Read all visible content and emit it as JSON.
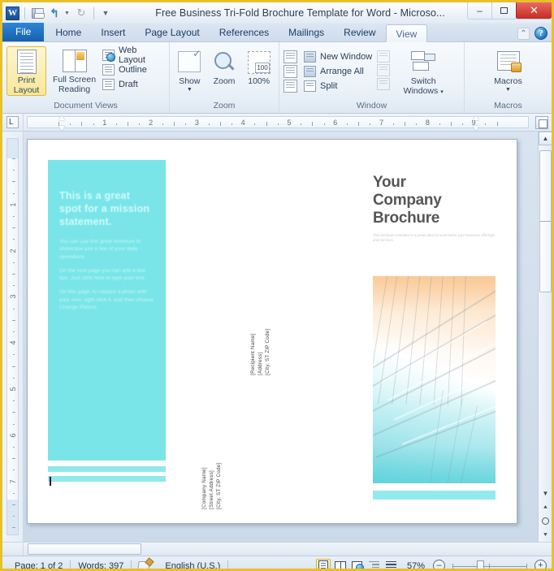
{
  "window": {
    "title": "Free Business Tri-Fold Brochure Template for Word  - Microso...",
    "app_icon": "W",
    "quick_access": [
      {
        "name": "save-icon",
        "label": "Save"
      },
      {
        "name": "undo-icon",
        "label": "Undo"
      },
      {
        "name": "redo-icon",
        "label": "Redo"
      },
      {
        "name": "customize-qat-icon",
        "label": "Customize Quick Access Toolbar"
      }
    ],
    "controls": {
      "minimize": "–",
      "maximize": "",
      "close": "✕"
    }
  },
  "tabs": [
    {
      "label": "File",
      "active": false,
      "is_file": true
    },
    {
      "label": "Home",
      "active": false
    },
    {
      "label": "Insert",
      "active": false
    },
    {
      "label": "Page Layout",
      "active": false
    },
    {
      "label": "References",
      "active": false
    },
    {
      "label": "Mailings",
      "active": false
    },
    {
      "label": "Review",
      "active": false
    },
    {
      "label": "View",
      "active": true
    }
  ],
  "tab_right": {
    "minimize_ribbon": "⌃",
    "help": "?"
  },
  "ribbon": {
    "groups": [
      {
        "name": "document-views",
        "label": "Document Views",
        "big_buttons": [
          {
            "label_line1": "Print",
            "label_line2": "Layout",
            "selected": true,
            "icon": "print-layout-icon"
          },
          {
            "label_line1": "Full Screen",
            "label_line2": "Reading",
            "selected": false,
            "icon": "full-screen-reading-icon"
          }
        ],
        "small_items": [
          {
            "label": "Web Layout",
            "icon": "web-layout-icon"
          },
          {
            "label": "Outline",
            "icon": "outline-icon"
          },
          {
            "label": "Draft",
            "icon": "draft-icon"
          }
        ]
      },
      {
        "name": "zoom",
        "label": "Zoom",
        "buttons": [
          {
            "label": "Show",
            "icon": "show-icon",
            "has_dropdown": true
          },
          {
            "label": "Zoom",
            "icon": "zoom-magnifier-icon",
            "has_dropdown": false
          },
          {
            "label": "100%",
            "icon": "one-hundred-percent-icon",
            "has_dropdown": false
          }
        ]
      },
      {
        "name": "window",
        "label": "Window",
        "small_items": [
          {
            "label": "New Window",
            "icon": "new-window-icon"
          },
          {
            "label": "Arrange All",
            "icon": "arrange-all-icon"
          },
          {
            "label": "Split",
            "icon": "split-icon"
          }
        ],
        "buttons": [
          {
            "label_line1": "Switch",
            "label_line2": "Windows",
            "icon": "switch-windows-icon",
            "has_dropdown": true
          }
        ]
      },
      {
        "name": "macros",
        "label": "Macros",
        "buttons": [
          {
            "label": "Macros",
            "icon": "macros-icon",
            "has_dropdown": true
          }
        ]
      }
    ]
  },
  "ruler": {
    "horizontal_numbers": [
      "1",
      "2",
      "3",
      "4",
      "5",
      "6",
      "7",
      "8",
      "9"
    ],
    "vertical_numbers": [
      "1",
      "2",
      "3",
      "4",
      "5",
      "6",
      "7"
    ],
    "tab_selector_icon": "left-tab-stop-icon",
    "view_ruler_icon": "view-ruler-icon"
  },
  "document": {
    "left_panel": {
      "mission_heading": "This is a great spot for a mission statement.",
      "paragraphs": [
        "You can use this great brochure to showcase just a few of your daily operations.",
        "On the next page you can add a few tips. Just click here to type your text.",
        "On this page, to replace a photo with your own, right-click it, and then choose Change Picture."
      ]
    },
    "mailing_block": {
      "recipient": "[Recipient Name]\n[Address]\n[City, ST  ZIP Code]",
      "company": "[Company Name]\n[Street Address]\n[City, ST  ZIP Code]"
    },
    "right_panel": {
      "title_lines": [
        "Your",
        "Company",
        "Brochure"
      ],
      "subtext": "This brochure template is a great place to summarize your business offerings and services."
    },
    "photo_alt": "glass-building-architecture-photo",
    "accent_color": "#79e5e8"
  },
  "status_bar": {
    "page": "Page: 1 of 2",
    "words": "Words: 397",
    "proofing_icon": "proofing-errors-icon",
    "language": "English (U.S.)",
    "view_buttons": [
      {
        "name": "print-layout-view-button",
        "label": "Print Layout",
        "selected": true
      },
      {
        "name": "full-screen-reading-view-button",
        "label": "Full Screen Reading",
        "selected": false
      },
      {
        "name": "web-layout-view-button",
        "label": "Web Layout",
        "selected": false
      },
      {
        "name": "outline-view-button",
        "label": "Outline",
        "selected": false
      },
      {
        "name": "draft-view-button",
        "label": "Draft",
        "selected": false
      }
    ],
    "zoom_level": "57%",
    "zoom_out": "–",
    "zoom_in": "+"
  }
}
